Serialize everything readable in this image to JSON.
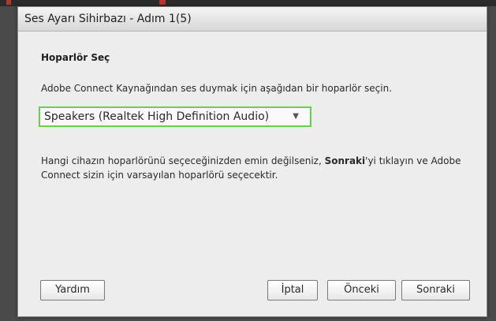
{
  "dialog": {
    "title": "Ses Ayarı Sihirbazı - Adım 1(5)"
  },
  "speaker_section": {
    "heading": "Hoparlör Seç",
    "instruction": "Adobe Connect Kaynağından ses duymak için aşağıdan bir hoparlör seçin.",
    "selected_speaker": "Speakers (Realtek High Definition Audio)",
    "help_text_before": "Hangi cihazın hoparlörünü seçeceğinizden emin değilseniz, ",
    "help_text_bold": "Sonraki",
    "help_text_after": "'yi tıklayın ve Adobe Connect sizin için varsayılan hoparlörü seçecektir."
  },
  "buttons": {
    "help": "Yardım",
    "cancel": "İptal",
    "back": "Önceki",
    "next": "Sonraki"
  },
  "icons": {
    "dropdown": "chevron-down-icon"
  },
  "colors": {
    "select_focus_border": "#6ad04a",
    "dialog_background": "#ededed"
  }
}
